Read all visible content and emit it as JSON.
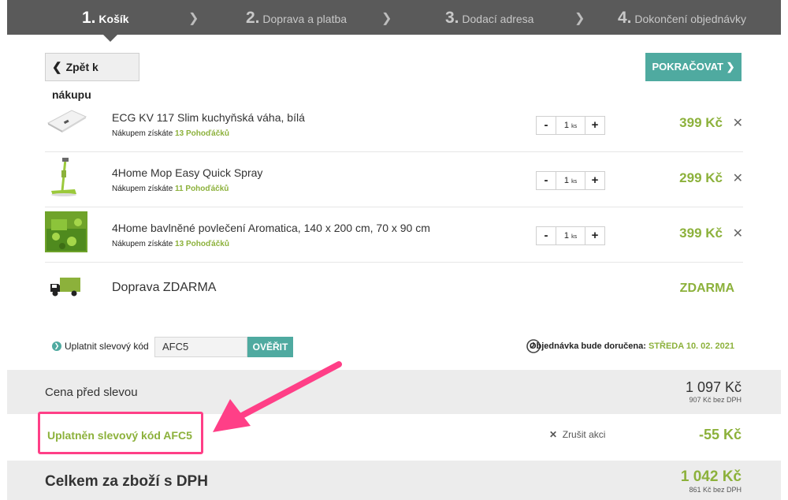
{
  "steps": [
    {
      "num": "1.",
      "label": "Košík"
    },
    {
      "num": "2.",
      "label": "Doprava a platba"
    },
    {
      "num": "3.",
      "label": "Dodací adresa"
    },
    {
      "num": "4.",
      "label": "Dokončení objednávky"
    }
  ],
  "buttons": {
    "back": "Zpět k nákupu",
    "continue": "POKRAČOVAT"
  },
  "items": [
    {
      "name": "ECG KV 117 Slim kuchyňská váha, bílá",
      "points_prefix": "Nákupem získáte",
      "points": "13 Pohoďáčků",
      "qty": "1",
      "unit": "ks",
      "price": "399 Kč"
    },
    {
      "name": "4Home Mop Easy Quick Spray",
      "points_prefix": "Nákupem získáte",
      "points": "11 Pohoďáčků",
      "qty": "1",
      "unit": "ks",
      "price": "299 Kč"
    },
    {
      "name": "4Home bavlněné povlečení Aromatica, 140 x 200 cm, 70 x 90 cm",
      "points_prefix": "Nákupem získáte",
      "points": "13 Pohoďáčků",
      "qty": "1",
      "unit": "ks",
      "price": "399 Kč"
    }
  ],
  "shipping": {
    "name": "Doprava ZDARMA",
    "price": "ZDARMA"
  },
  "coupon": {
    "label": "Uplatnit slevový kód",
    "value": "AFC5",
    "button": "OVĚŘIT"
  },
  "delivery": {
    "prefix": "Objednávka bude doručena:",
    "date": "STŘEDA 10. 02. 2021"
  },
  "summary": {
    "before_label": "Cena před slevou",
    "before_value": "1 097 Kč",
    "before_net": "907 Kč bez DPH",
    "discount_label": "Uplatněn slevový kód AFC5",
    "cancel_label": "Zrušit akci",
    "discount_value": "-55 Kč",
    "total_label": "Celkem za zboží s DPH",
    "total_value": "1 042 Kč",
    "total_net": "861 Kč bez DPH"
  },
  "colors": {
    "accent_green": "#8cb13b",
    "teal": "#4faaa0",
    "highlight_pink": "#ff3f87",
    "steps_bg": "#5a5a5a"
  },
  "icons": {
    "remove": "close-icon",
    "delivery": "clock-icon",
    "shipping": "truck-icon",
    "coupon": "chevron-right-circle-icon"
  }
}
